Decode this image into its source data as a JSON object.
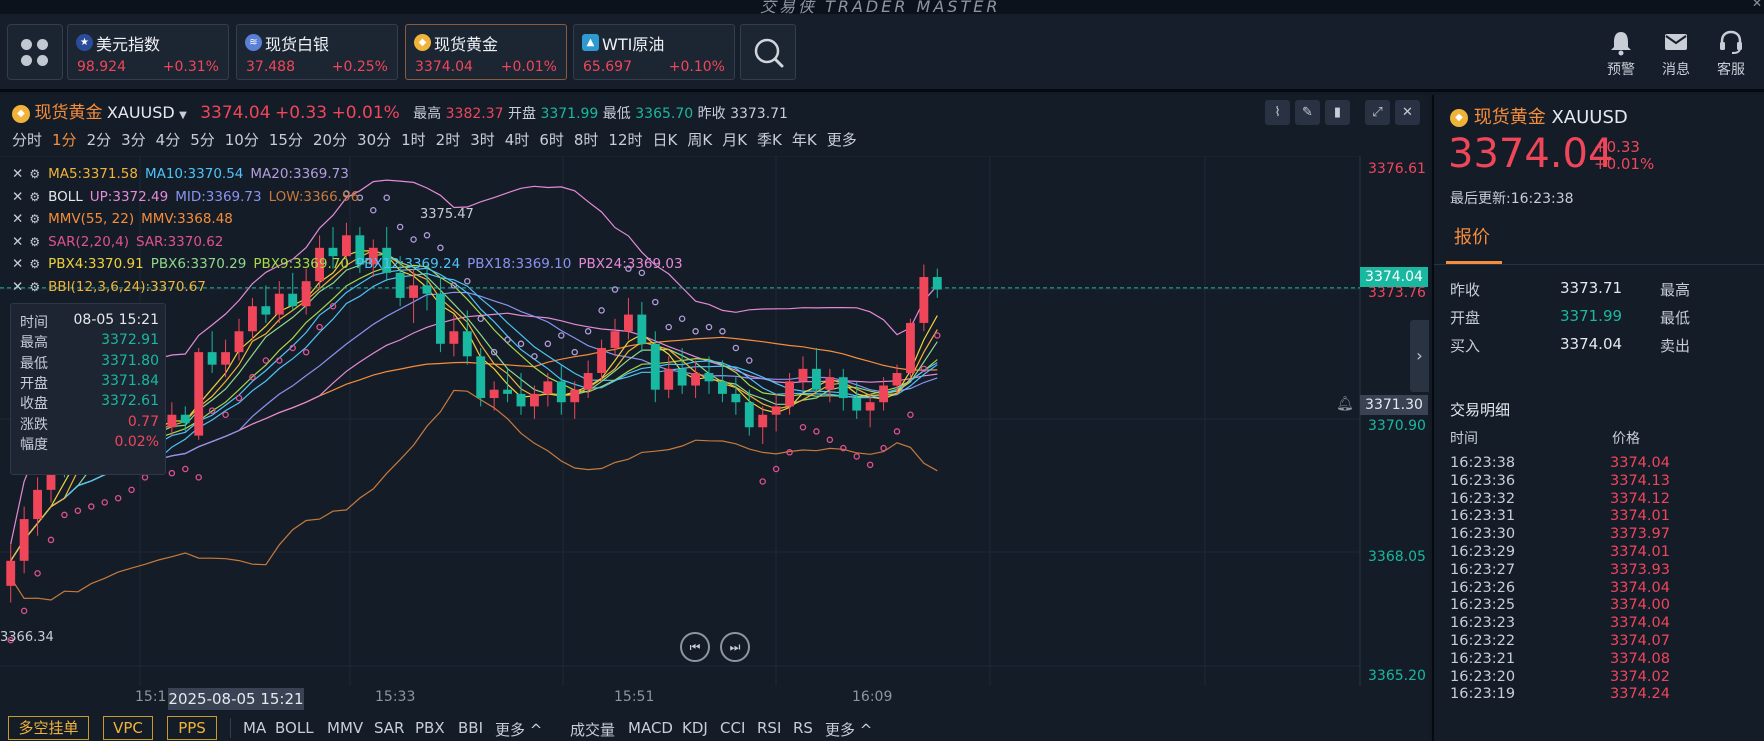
{
  "window": {
    "title": "交易侠 TRADER MASTER"
  },
  "header": {
    "tickers": [
      {
        "name": "美元指数",
        "price": "98.924",
        "change": "+0.31%",
        "icon": "us-flag-icon"
      },
      {
        "name": "现货白银",
        "price": "37.488",
        "change": "+0.25%",
        "icon": "silver-icon"
      },
      {
        "name": "现货黄金",
        "price": "3374.04",
        "change": "+0.01%",
        "icon": "gold-icon",
        "active": true
      },
      {
        "name": "WTI原油",
        "price": "65.697",
        "change": "+0.10%",
        "icon": "oil-icon"
      }
    ],
    "actions": [
      {
        "label": "预警",
        "icon": "bell-icon"
      },
      {
        "label": "消息",
        "icon": "mail-icon"
      },
      {
        "label": "客服",
        "icon": "headset-icon"
      }
    ]
  },
  "symbol": {
    "name": "现货黄金",
    "code": "XAUUSD",
    "price": "3374.04",
    "change": "+0.33",
    "change_pct": "+0.01%",
    "high_label": "最高",
    "high": "3382.37",
    "open_label": "开盘",
    "open": "3371.99",
    "low_label": "最低",
    "low": "3365.70",
    "prev_label": "昨收",
    "prev": "3373.71"
  },
  "timeframes": [
    "分时",
    "1分",
    "2分",
    "3分",
    "4分",
    "5分",
    "10分",
    "15分",
    "20分",
    "30分",
    "1时",
    "2时",
    "3时",
    "4时",
    "6时",
    "8时",
    "12时",
    "日K",
    "周K",
    "月K",
    "季K",
    "年K",
    "更多"
  ],
  "selected_timeframe": "1分",
  "indicators": [
    [
      {
        "t": "MA5:3371.58",
        "c": "#f0b33a"
      },
      {
        "t": "MA10:3370.54",
        "c": "#4fc3f7"
      },
      {
        "t": "MA20:3369.73",
        "c": "#b39ddb"
      }
    ],
    [
      {
        "t": "BOLL",
        "c": "#e6e9ee"
      },
      {
        "t": "UP:3372.49",
        "c": "#e58ad6"
      },
      {
        "t": "MID:3369.73",
        "c": "#8b93f0"
      },
      {
        "t": "LOW:3366.96",
        "c": "#c77a3c"
      }
    ],
    [
      {
        "t": "MMV(55, 22)",
        "c": "#f58d3a"
      },
      {
        "t": "MMV:3368.48",
        "c": "#f58d3a"
      }
    ],
    [
      {
        "t": "SAR(2,20,4)",
        "c": "#e0528f"
      },
      {
        "t": "SAR:3370.62",
        "c": "#e0528f"
      }
    ],
    [
      {
        "t": "PBX4:3370.91",
        "c": "#f0d23a"
      },
      {
        "t": "PBX6:3370.29",
        "c": "#8fd88a"
      },
      {
        "t": "PBX9:3369.70",
        "c": "#a8d84a"
      },
      {
        "t": "PBX12:3369.24",
        "c": "#4fc3f7"
      },
      {
        "t": "PBX18:3369.10",
        "c": "#8b93f0"
      },
      {
        "t": "PBX24:3369.03",
        "c": "#e58ad6"
      }
    ],
    [
      {
        "t": "BBI(12,3,6,24):3370.67",
        "c": "#f0b33a"
      }
    ]
  ],
  "infobox": {
    "rows": [
      {
        "k": "时间",
        "v": "08-05 15:21",
        "c": "#e6e9ee"
      },
      {
        "k": "最高",
        "v": "3372.91",
        "c": "#19b8a0"
      },
      {
        "k": "最低",
        "v": "3371.80",
        "c": "#19b8a0"
      },
      {
        "k": "开盘",
        "v": "3371.84",
        "c": "#19b8a0"
      },
      {
        "k": "收盘",
        "v": "3372.61",
        "c": "#19b8a0"
      },
      {
        "k": "涨跌",
        "v": "0.77",
        "c": "#f0465a"
      },
      {
        "k": "幅度",
        "v": "0.02%",
        "c": "#f0465a"
      }
    ]
  },
  "price_axis": {
    "labels": [
      "3376.61",
      "3373.76",
      "3370.90",
      "3368.05",
      "3365.20"
    ],
    "current_badge": "3374.04",
    "crosshair_badge": "3371.30",
    "high_marker": "3375.47",
    "low_marker": "3366.34"
  },
  "time_axis": {
    "labels": [
      "15:1",
      "15:33",
      "15:51",
      "16:09"
    ],
    "crosshair": "2025-08-05 15:21"
  },
  "bottom": {
    "tabs": [
      "多空挂单",
      "VPC",
      "PPS"
    ],
    "main_indicators": [
      "MA",
      "BOLL",
      "MMV",
      "SAR",
      "PBX",
      "BBI",
      "更多 ^"
    ],
    "sub_indicators": [
      "成交量",
      "MACD",
      "KDJ",
      "CCI",
      "RSI",
      "RS",
      "更多 ^"
    ]
  },
  "chart_data": {
    "type": "candlestick",
    "yrange": [
      3364.5,
      3377.2
    ],
    "candles": [
      [
        3366.9,
        3367.9,
        3366.5,
        3367.5
      ],
      [
        3367.5,
        3368.8,
        3367.2,
        3368.5
      ],
      [
        3368.5,
        3369.5,
        3368.1,
        3369.2
      ],
      [
        3369.2,
        3370.3,
        3368.9,
        3370.0
      ],
      [
        3370.0,
        3370.8,
        3369.5,
        3369.8
      ],
      [
        3369.8,
        3371.2,
        3369.6,
        3370.8
      ],
      [
        3370.8,
        3371.0,
        3369.7,
        3370.1
      ],
      [
        3370.1,
        3370.9,
        3369.8,
        3370.6
      ],
      [
        3370.6,
        3371.0,
        3369.9,
        3370.3
      ],
      [
        3370.3,
        3371.0,
        3370.1,
        3370.8
      ],
      [
        3370.8,
        3371.2,
        3370.4,
        3370.9
      ],
      [
        3370.9,
        3371.4,
        3370.6,
        3370.7
      ],
      [
        3370.7,
        3371.3,
        3370.5,
        3371.0
      ],
      [
        3371.0,
        3371.2,
        3370.6,
        3370.8
      ],
      [
        3370.5,
        3372.6,
        3370.4,
        3372.5
      ],
      [
        3372.5,
        3373.0,
        3372.0,
        3372.2
      ],
      [
        3372.2,
        3372.8,
        3371.9,
        3372.5
      ],
      [
        3372.5,
        3373.3,
        3372.3,
        3373.0
      ],
      [
        3373.0,
        3373.8,
        3372.8,
        3373.6
      ],
      [
        3373.6,
        3374.1,
        3373.2,
        3373.4
      ],
      [
        3373.4,
        3374.2,
        3373.2,
        3373.9
      ],
      [
        3373.9,
        3374.4,
        3373.5,
        3373.6
      ],
      [
        3373.6,
        3374.5,
        3373.4,
        3374.2
      ],
      [
        3374.2,
        3375.3,
        3374.0,
        3375.0
      ],
      [
        3375.0,
        3375.5,
        3374.5,
        3374.8
      ],
      [
        3374.8,
        3375.6,
        3374.6,
        3375.3
      ],
      [
        3375.3,
        3375.5,
        3374.4,
        3374.6
      ],
      [
        3374.6,
        3375.2,
        3374.3,
        3375.0
      ],
      [
        3375.0,
        3375.5,
        3374.2,
        3374.4
      ],
      [
        3374.4,
        3374.8,
        3373.6,
        3373.8
      ],
      [
        3373.8,
        3374.5,
        3373.2,
        3374.1
      ],
      [
        3374.1,
        3374.6,
        3373.5,
        3373.9
      ],
      [
        3373.9,
        3374.3,
        3372.5,
        3372.7
      ],
      [
        3372.7,
        3373.4,
        3372.4,
        3373.0
      ],
      [
        3373.0,
        3373.5,
        3372.2,
        3372.4
      ],
      [
        3372.4,
        3372.6,
        3371.2,
        3371.4
      ],
      [
        3371.4,
        3371.8,
        3371.1,
        3371.6
      ],
      [
        3371.6,
        3372.1,
        3371.3,
        3371.5
      ],
      [
        3371.5,
        3372.0,
        3371.0,
        3371.2
      ],
      [
        3371.2,
        3371.7,
        3370.9,
        3371.5
      ],
      [
        3371.5,
        3372.0,
        3371.2,
        3371.8
      ],
      [
        3371.8,
        3372.2,
        3371.0,
        3371.3
      ],
      [
        3371.3,
        3371.8,
        3370.9,
        3371.6
      ],
      [
        3371.6,
        3372.3,
        3371.4,
        3372.0
      ],
      [
        3372.0,
        3372.8,
        3371.8,
        3372.6
      ],
      [
        3372.6,
        3373.3,
        3372.4,
        3373.0
      ],
      [
        3373.0,
        3373.8,
        3372.8,
        3373.4
      ],
      [
        3373.4,
        3373.7,
        3372.5,
        3372.7
      ],
      [
        3372.7,
        3373.0,
        3371.3,
        3371.6
      ],
      [
        3371.6,
        3372.4,
        3371.4,
        3372.1
      ],
      [
        3372.1,
        3372.6,
        3371.5,
        3371.7
      ],
      [
        3371.7,
        3372.3,
        3371.4,
        3372.0
      ],
      [
        3372.0,
        3372.4,
        3371.5,
        3371.8
      ],
      [
        3371.8,
        3372.3,
        3371.3,
        3371.5
      ],
      [
        3371.5,
        3371.9,
        3371.0,
        3371.3
      ],
      [
        3371.3,
        3371.6,
        3370.5,
        3370.7
      ],
      [
        3370.7,
        3371.2,
        3370.3,
        3371.0
      ],
      [
        3371.0,
        3371.5,
        3370.6,
        3371.2
      ],
      [
        3371.2,
        3372.0,
        3371.0,
        3371.8
      ],
      [
        3371.8,
        3372.4,
        3371.6,
        3372.1
      ],
      [
        3372.1,
        3372.6,
        3371.5,
        3371.6
      ],
      [
        3371.6,
        3372.1,
        3371.3,
        3371.9
      ],
      [
        3371.9,
        3372.1,
        3371.1,
        3371.4
      ],
      [
        3371.4,
        3371.8,
        3370.9,
        3371.1
      ],
      [
        3371.1,
        3371.5,
        3370.7,
        3371.3
      ],
      [
        3371.3,
        3371.9,
        3371.1,
        3371.7
      ],
      [
        3371.7,
        3372.2,
        3371.5,
        3372.0
      ],
      [
        3372.0,
        3373.3,
        3371.9,
        3373.2
      ],
      [
        3373.2,
        3374.6,
        3373.0,
        3374.3
      ],
      [
        3374.3,
        3374.5,
        3373.8,
        3374.0
      ]
    ]
  },
  "right_panel": {
    "name": "现货黄金",
    "code": "XAUUSD",
    "price": "3374.04",
    "change": "+0.33",
    "change_pct": "+0.01%",
    "updated": "最后更新:16:23:38",
    "tab": "报价",
    "quotes": [
      {
        "k1": "昨收",
        "v1": "3373.71",
        "c": "#e6e9ee",
        "k2": "最高"
      },
      {
        "k1": "开盘",
        "v1": "3371.99",
        "c": "#19b8a0",
        "k2": "最低"
      },
      {
        "k1": "买入",
        "v1": "3374.04",
        "c": "#e6e9ee",
        "k2": "卖出"
      }
    ],
    "trade_title": "交易明细",
    "trade_headers": [
      "时间",
      "价格"
    ],
    "trades": [
      [
        "16:23:38",
        "3374.04"
      ],
      [
        "16:23:36",
        "3374.13"
      ],
      [
        "16:23:32",
        "3374.12"
      ],
      [
        "16:23:31",
        "3374.01"
      ],
      [
        "16:23:30",
        "3373.97"
      ],
      [
        "16:23:29",
        "3374.01"
      ],
      [
        "16:23:27",
        "3373.93"
      ],
      [
        "16:23:26",
        "3374.04"
      ],
      [
        "16:23:25",
        "3374.00"
      ],
      [
        "16:23:23",
        "3374.04"
      ],
      [
        "16:23:22",
        "3374.07"
      ],
      [
        "16:23:21",
        "3374.08"
      ],
      [
        "16:23:20",
        "3374.02"
      ],
      [
        "16:23:19",
        "3374.24"
      ]
    ]
  },
  "colors": {
    "up": "#f0465a",
    "down": "#19b8a0",
    "accent": "#f58d3a",
    "background": "#141c28"
  }
}
